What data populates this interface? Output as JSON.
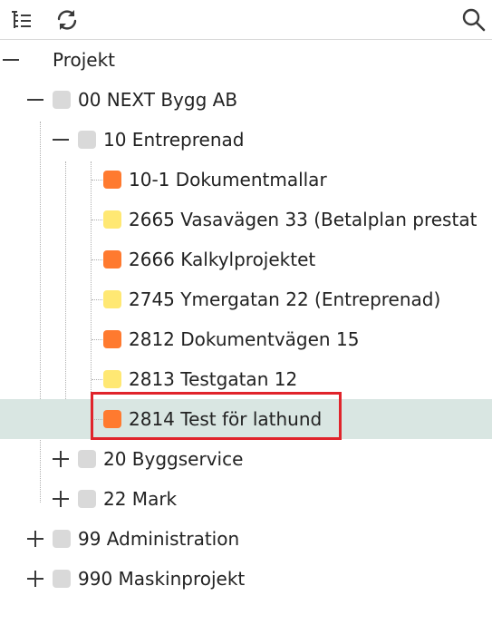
{
  "toolbar": {
    "tree_view_icon": "tree-list-icon",
    "refresh_icon": "refresh-icon",
    "search_icon": "search-icon"
  },
  "tree": {
    "root": {
      "label": "Projekt",
      "expanded": true
    },
    "company": {
      "label": "00 NEXT Bygg AB",
      "expanded": true
    },
    "entreprenad": {
      "label": "10 Entreprenad",
      "expanded": true
    },
    "projects": [
      {
        "label": "10-1 Dokumentmallar",
        "status_color": "#ff7a2f"
      },
      {
        "label": "2665 Vasavägen 33 (Betalplan prestat",
        "status_color": "#ffe873"
      },
      {
        "label": "2666 Kalkylprojektet",
        "status_color": "#ff7a2f"
      },
      {
        "label": "2745 Ymergatan 22 (Entreprenad)",
        "status_color": "#ffe873"
      },
      {
        "label": "2812 Dokumentvägen 15",
        "status_color": "#ff7a2f"
      },
      {
        "label": "2813 Testgatan 12",
        "status_color": "#ffe873"
      },
      {
        "label": "2814 Test för lathund",
        "status_color": "#ff7a2f",
        "selected": true
      }
    ],
    "byggservice": {
      "label": "20 Byggservice",
      "expanded": false
    },
    "mark": {
      "label": "22 Mark",
      "expanded": false
    },
    "administration": {
      "label": "99 Administration",
      "expanded": false
    },
    "maskinprojekt": {
      "label": "990 Maskinprojekt",
      "expanded": false
    }
  },
  "colors": {
    "accent_highlight": "#e0242b",
    "selected_row": "#d9e6e2",
    "folder_grey": "#d9d9d9",
    "status_orange": "#ff7a2f",
    "status_yellow": "#ffe873"
  }
}
